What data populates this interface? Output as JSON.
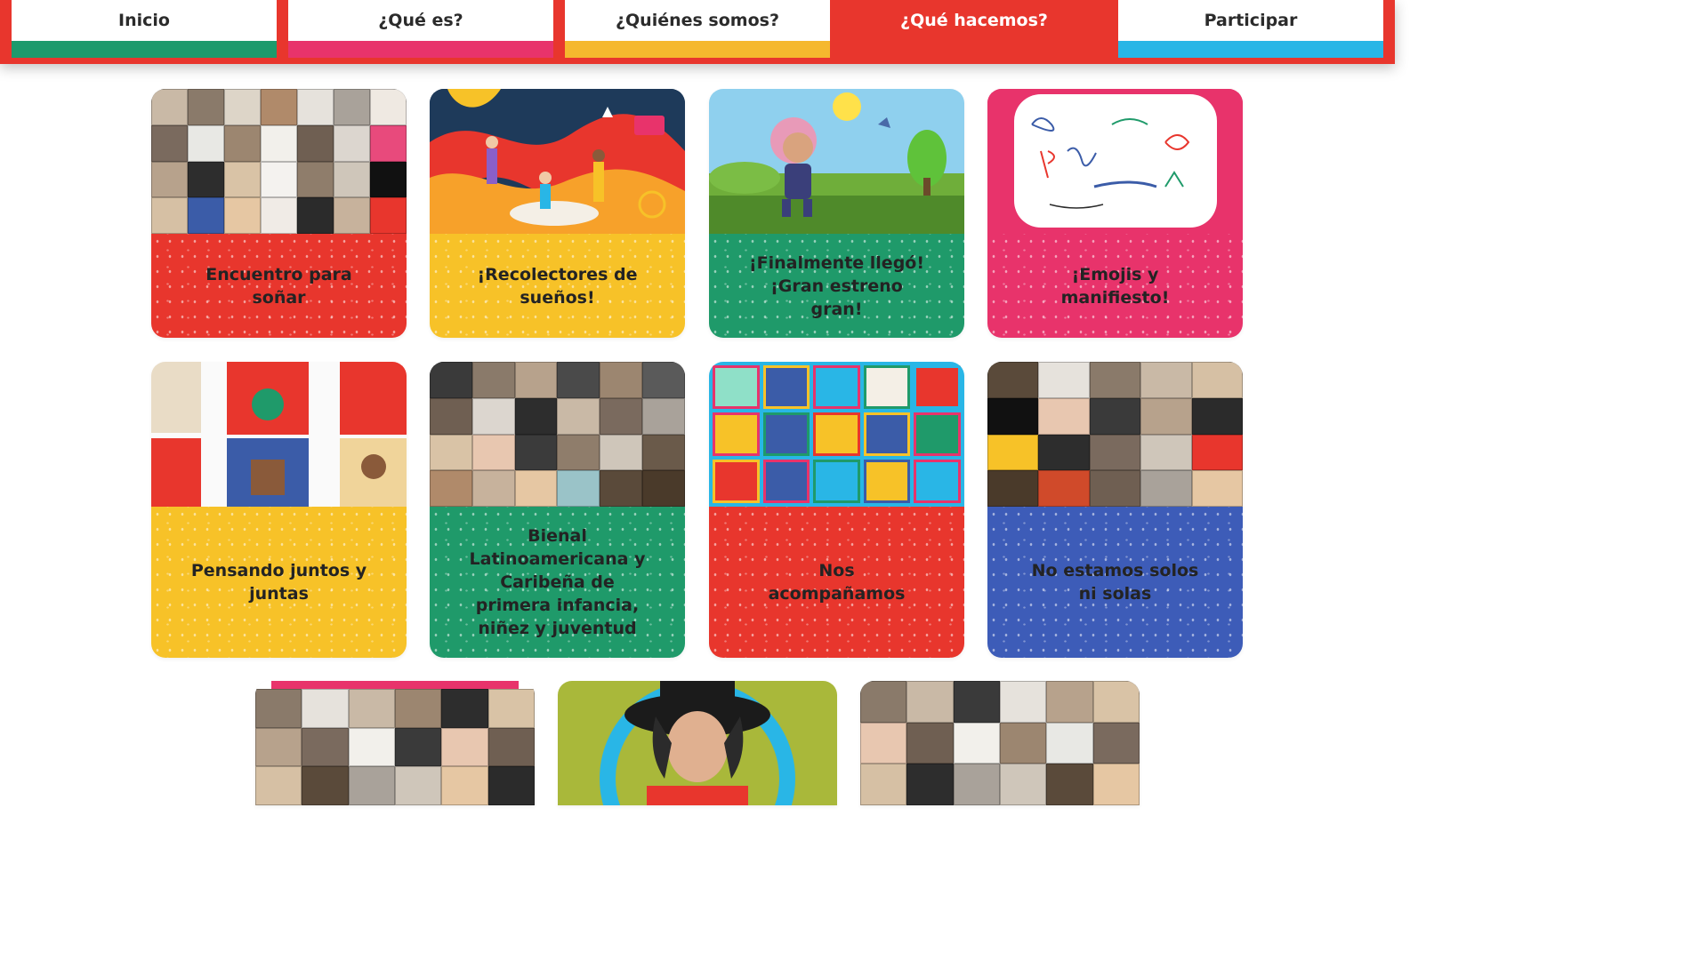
{
  "nav": {
    "items": [
      {
        "label": "Inicio",
        "color": "#1d9a6c"
      },
      {
        "label": "¿Qué es?",
        "color": "#e8336b"
      },
      {
        "label": "¿Quiénes somos?",
        "color": "#f5b82e"
      },
      {
        "label": "¿Qué hacemos?",
        "color": "#e8362d",
        "active": true
      },
      {
        "label": "Participar",
        "color": "#29b6e6"
      }
    ]
  },
  "cards": [
    {
      "title": "Encuentro para soñar",
      "panel_color": "#e8362d",
      "image": "video-call-grid-holding-signs"
    },
    {
      "title": "¡Recolectores de sueños!",
      "panel_color": "#f7c228",
      "image": "illustration-children-dreams"
    },
    {
      "title": "¡Finalmente llegó! ¡Gran estreno gran!",
      "panel_color": "#1f9a6a",
      "image": "animated-girl-jumping"
    },
    {
      "title": "¡Emojis y manifiesto!",
      "panel_color": "#e8336b",
      "image": "whiteboard-handwritten-names"
    },
    {
      "title": "Pensando juntos y juntas",
      "panel_color": "#f7c228",
      "image": "collage-posters"
    },
    {
      "title": "Bienal Latinoamericana y Caribeña de primera infancia, niñez y juventud",
      "panel_color": "#1f9a6a",
      "image": "video-call-grid"
    },
    {
      "title": "Nos acompañamos",
      "panel_color": "#e8362d",
      "image": "emoji-drawings-grid"
    },
    {
      "title": "No estamos solos ni solas",
      "panel_color": "#3d5cb8",
      "image": "video-call-grid-kids"
    },
    {
      "title": "",
      "panel_color": "#ffffff",
      "image": "video-call-grid-2"
    },
    {
      "title": "",
      "panel_color": "#ffffff",
      "image": "performer-with-hat"
    },
    {
      "title": "",
      "panel_color": "#ffffff",
      "image": "video-call-grid-3"
    }
  ]
}
